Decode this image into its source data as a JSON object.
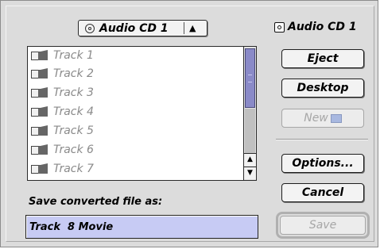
{
  "source_popup": {
    "label": "Audio CD 1",
    "arrows": "▲▼"
  },
  "volume": {
    "label": "Audio CD 1"
  },
  "file_list": {
    "items": [
      "Track 1",
      "Track 2",
      "Track 3",
      "Track 4",
      "Track 5",
      "Track 6",
      "Track 7"
    ]
  },
  "buttons": {
    "eject": "Eject",
    "desktop": "Desktop",
    "new": "New",
    "options": "Options...",
    "cancel": "Cancel",
    "save": "Save"
  },
  "save_as": {
    "label": "Save converted file as:",
    "value": "Track  8 Movie"
  },
  "colors": {
    "selection": "#c7cbf4",
    "scroll_thumb": "#8a8ac8",
    "dialog_bg": "#dcdcdc"
  }
}
